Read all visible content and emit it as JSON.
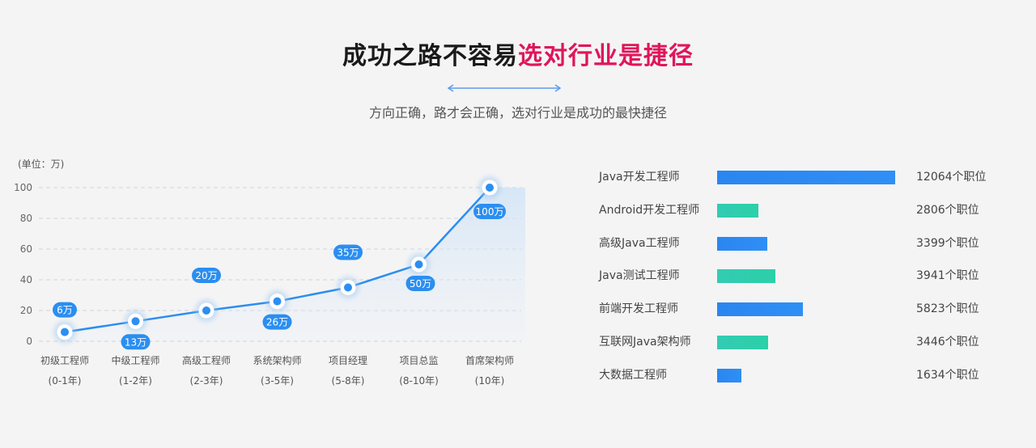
{
  "header": {
    "title_main": "成功之路不容易",
    "title_accent": "选对行业是捷径",
    "subtitle": "方向正确，路才会正确，选对行业是成功的最快捷径"
  },
  "colors": {
    "accent_red": "#e0155a",
    "line_blue": "#2b8ef0",
    "bar_blue": "#2a86f0",
    "bar_teal": "#2fcfb0"
  },
  "chart_data": [
    {
      "type": "line",
      "title": "",
      "unit_label": "(单位：万)",
      "ylim": [
        0,
        100
      ],
      "yticks": [
        "0",
        "20",
        "40",
        "60",
        "80",
        "100"
      ],
      "grid": true,
      "categories": [
        {
          "name": "初级工程师",
          "years": "(0-1年)"
        },
        {
          "name": "中级工程师",
          "years": "(1-2年)"
        },
        {
          "name": "高级工程师",
          "years": "(2-3年)"
        },
        {
          "name": "系统架构师",
          "years": "(3-5年)"
        },
        {
          "name": "项目经理",
          "years": "(5-8年)"
        },
        {
          "name": "项目总监",
          "years": "(8-10年)"
        },
        {
          "name": "首席架构师",
          "years": "(10年)"
        }
      ],
      "values": [
        6,
        13,
        20,
        26,
        35,
        50,
        100
      ],
      "data_labels": [
        "6万",
        "13万",
        "20万",
        "26万",
        "35万",
        "50万",
        "100万"
      ]
    },
    {
      "type": "bar",
      "orientation": "horizontal",
      "categories": [
        "Java开发工程师",
        "Android开发工程师",
        "高级Java工程师",
        "Java测试工程师",
        "前端开发工程师",
        "互联网Java架构师",
        "大数据工程师"
      ],
      "values": [
        12064,
        2806,
        3399,
        3941,
        5823,
        3446,
        1634
      ],
      "value_labels": [
        "12064个职位",
        "2806个职位",
        "3399个职位",
        "3941个职位",
        "5823个职位",
        "3446个职位",
        "1634个职位"
      ],
      "bar_colors": [
        "blue",
        "teal",
        "blue",
        "teal",
        "blue",
        "teal",
        "blue"
      ]
    }
  ]
}
